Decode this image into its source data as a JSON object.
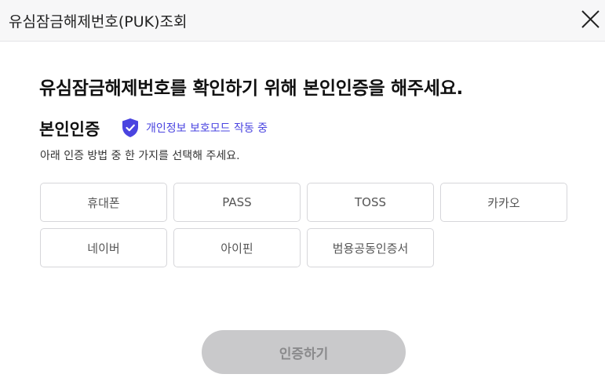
{
  "header": {
    "title": "유심잠금해제번호(PUK)조회",
    "close_icon": "close-icon"
  },
  "main": {
    "headline": "유심잠금해제번호를 확인하기 위해 본인인증을 해주세요.",
    "section_title": "본인인증",
    "privacy_badge": {
      "icon": "shield-check-icon",
      "text": "개인정보 보호모드 작동 중",
      "color": "#4a44e0"
    },
    "instruction": "아래 인증 방법 중 한 가지를 선택해 주세요.",
    "methods": [
      {
        "label": "휴대폰"
      },
      {
        "label": "PASS"
      },
      {
        "label": "TOSS"
      },
      {
        "label": "카카오"
      },
      {
        "label": "네이버"
      },
      {
        "label": "아이핀"
      },
      {
        "label": "범용공동인증서"
      }
    ],
    "submit_label": "인증하기"
  },
  "colors": {
    "accent": "#4a44e0",
    "button_disabled_bg": "#c9c9cb",
    "button_disabled_text": "#8a8a8c",
    "border": "#d6d6da"
  }
}
